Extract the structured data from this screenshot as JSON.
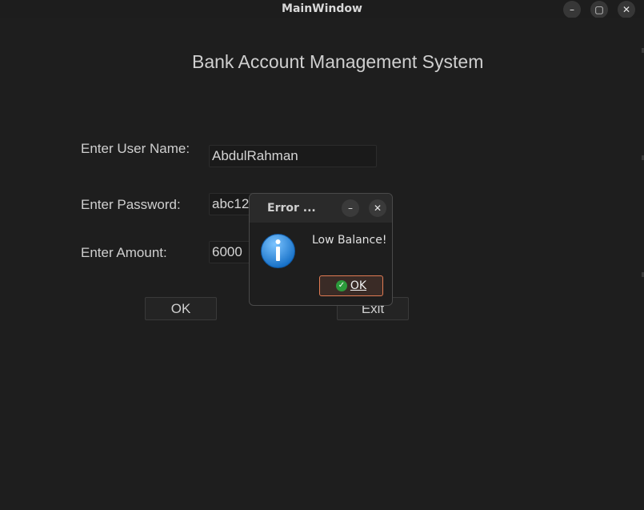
{
  "window": {
    "title": "MainWindow",
    "minimize_icon": "minimize-icon",
    "maximize_icon": "maximize-icon",
    "close_icon": "close-icon"
  },
  "form": {
    "heading": "Bank Account Management System",
    "username_label": "Enter User Name:",
    "username_value": "AbdulRahman",
    "password_label": "Enter Password:",
    "password_value": "abc123",
    "amount_label": "Enter Amount:",
    "amount_value": "6000",
    "ok_label": "OK",
    "exit_label": "Exit"
  },
  "dialog": {
    "title": "Error ...",
    "message": "Low Balance!",
    "ok_label": "OK",
    "icon": "info-icon",
    "accent_color": "#e07b53"
  }
}
